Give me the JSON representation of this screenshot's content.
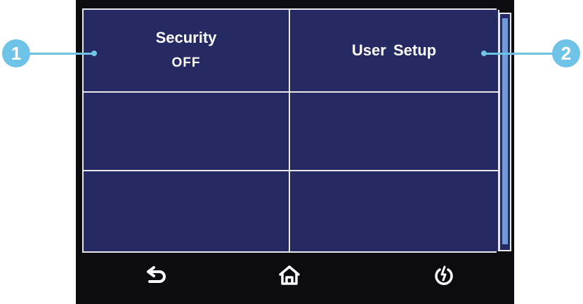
{
  "menu": {
    "cells": [
      {
        "title": "Security",
        "value": "OFF"
      },
      {
        "title": "User  Setup",
        "value": ""
      },
      {
        "title": "",
        "value": ""
      },
      {
        "title": "",
        "value": ""
      },
      {
        "title": "",
        "value": ""
      },
      {
        "title": "",
        "value": ""
      }
    ]
  },
  "navbar": {
    "icons": [
      "back-arrow-icon",
      "home-icon",
      "power-icon"
    ]
  },
  "callouts": [
    {
      "number": "1"
    },
    {
      "number": "2"
    }
  ],
  "colors": {
    "panel": "#262a63",
    "border": "#e8e8ee",
    "device": "#0b0b10",
    "accent": "#6fc3e6",
    "scroll_thumb": "#6f9bd6"
  }
}
